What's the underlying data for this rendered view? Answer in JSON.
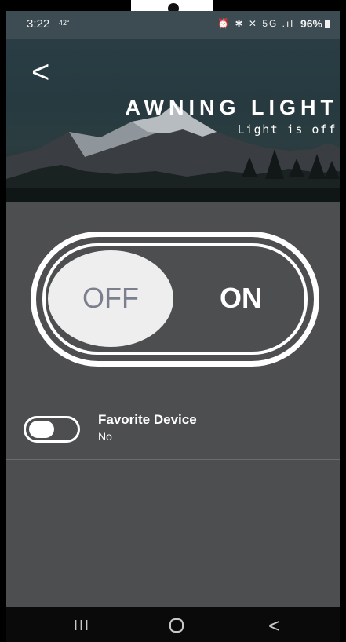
{
  "status_bar": {
    "time": "3:22",
    "temperature": "42°",
    "icons": "⏰ ✱ ✕ 5G .ıl",
    "battery": "96%"
  },
  "header": {
    "back_icon": "back-arrow-icon",
    "title": "AWNING LIGHT",
    "subtitle": "Light is off"
  },
  "power_toggle": {
    "off_label": "OFF",
    "on_label": "ON",
    "state": "off"
  },
  "favorite": {
    "title": "Favorite Device",
    "value": "No",
    "enabled": false
  },
  "navbar": {
    "recents_icon": "recents-icon",
    "home_icon": "home-icon",
    "back_icon": "back-icon",
    "recents_glyph": "III",
    "back_glyph": "<"
  },
  "colors": {
    "background": "#4d4e50",
    "header_bg": "#2a3d45",
    "accent": "#ffffff",
    "off_text": "#7b7f8e"
  }
}
